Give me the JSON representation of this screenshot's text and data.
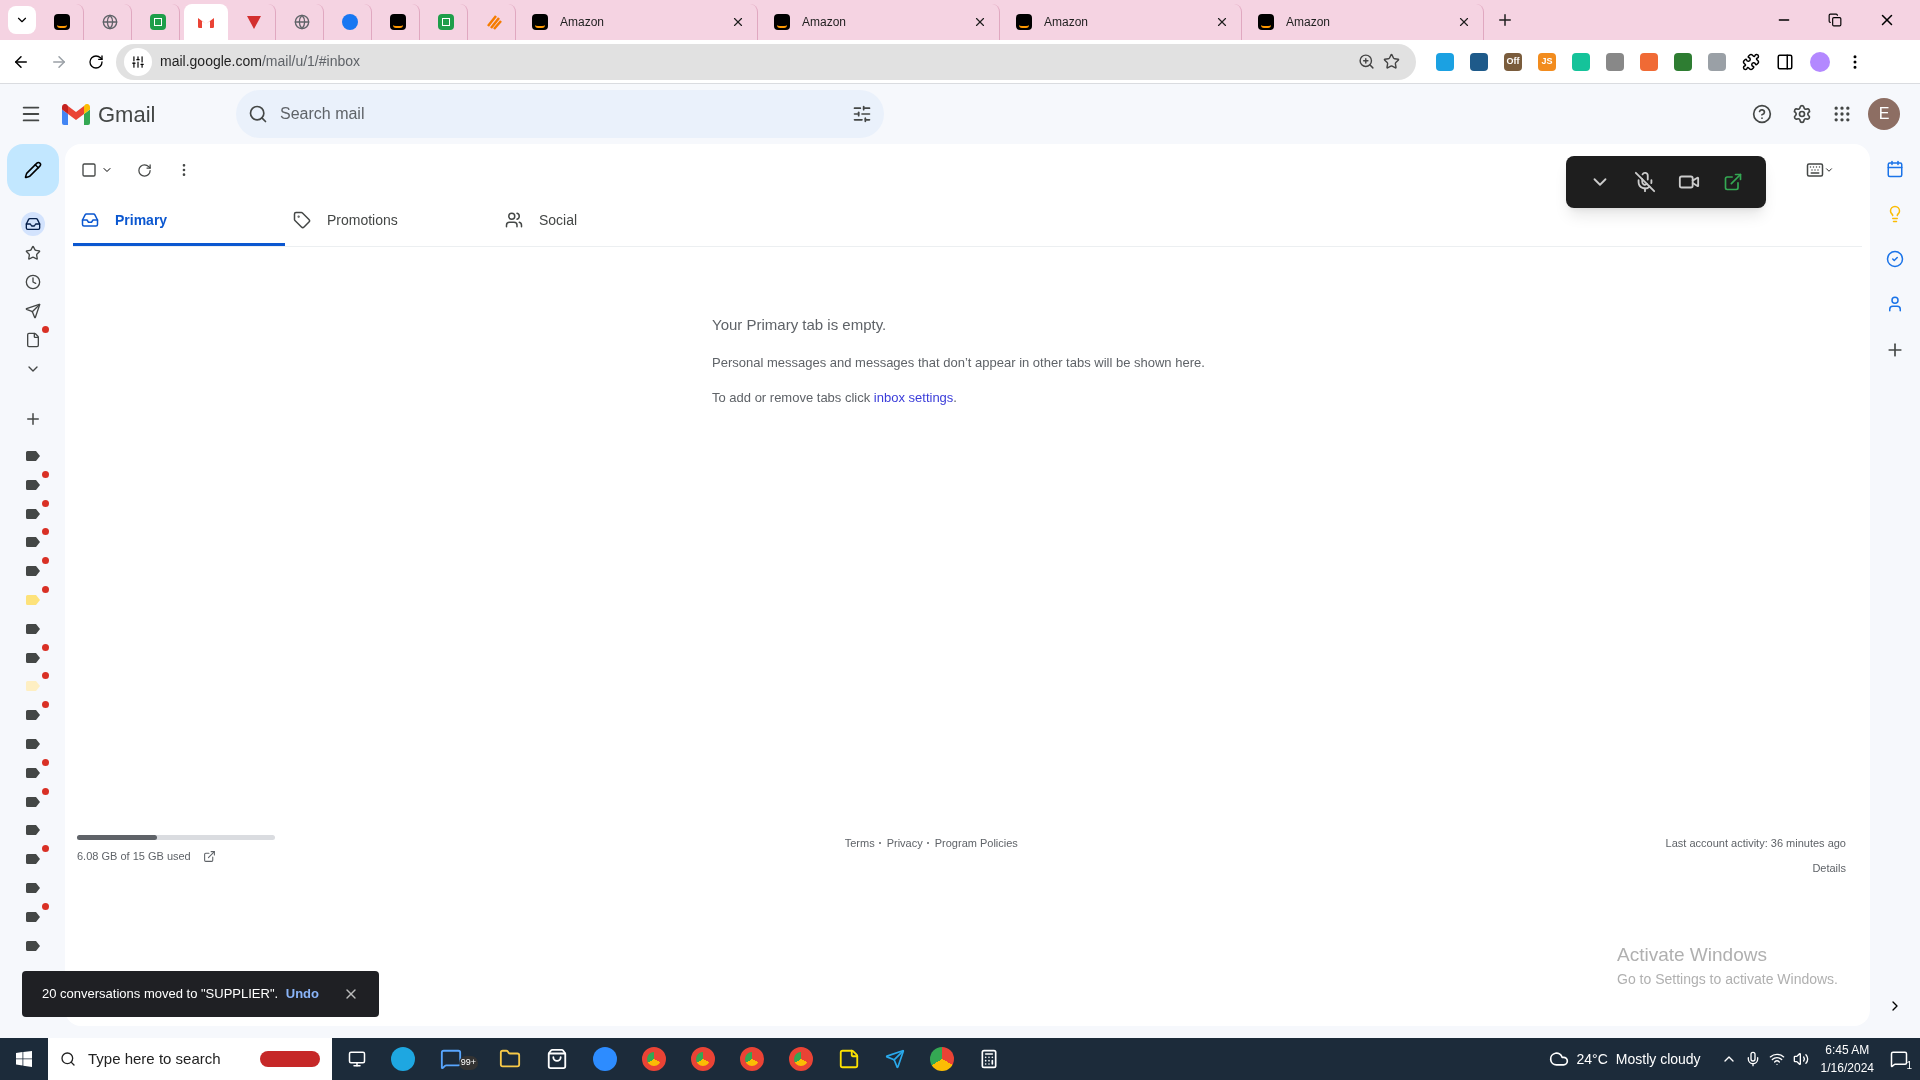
{
  "browser": {
    "tabs": [
      {
        "kind": "amazon",
        "selected": false
      },
      {
        "kind": "globe",
        "selected": false
      },
      {
        "kind": "sheets",
        "selected": false
      },
      {
        "kind": "gmail",
        "selected": true
      },
      {
        "kind": "shield",
        "selected": false
      },
      {
        "kind": "globe",
        "selected": false
      },
      {
        "kind": "facebook",
        "selected": false
      },
      {
        "kind": "amazon",
        "selected": false
      },
      {
        "kind": "sheets",
        "selected": false
      },
      {
        "kind": "stripes",
        "selected": false
      },
      {
        "kind": "amazon",
        "selected": false,
        "label": "Amazon"
      },
      {
        "kind": "amazon",
        "selected": false,
        "label": "Amazon"
      },
      {
        "kind": "amazon",
        "selected": false,
        "label": "Amazon"
      },
      {
        "kind": "amazon",
        "selected": false,
        "label": "Amazon"
      }
    ],
    "url_host": "mail.google.com",
    "url_path": "/mail/u/1/#inbox",
    "extensions": [
      {
        "color": "#1ba1e2"
      },
      {
        "color": "#1e5a8a"
      },
      {
        "color": "#7a5c3c",
        "label": "Off"
      },
      {
        "color": "#f28c1e",
        "label": "JS"
      },
      {
        "color": "#15c39a"
      },
      {
        "color": "#888888"
      },
      {
        "color": "#f06a35"
      },
      {
        "color": "#2e7d32"
      },
      {
        "color": "#9aa0a6"
      }
    ]
  },
  "gmail": {
    "logo_text": "Gmail",
    "search": {
      "placeholder": "Search mail"
    },
    "avatar": "E",
    "rail": [
      {
        "kind": "inbox",
        "selected": true,
        "dot": false
      },
      {
        "kind": "star",
        "selected": false,
        "dot": false
      },
      {
        "kind": "clock",
        "selected": false,
        "dot": false
      },
      {
        "kind": "send",
        "selected": false,
        "dot": false
      },
      {
        "kind": "draft",
        "selected": false,
        "dot": true
      },
      {
        "kind": "more",
        "selected": false,
        "dot": false
      }
    ],
    "labels": [
      {
        "color": "#444746",
        "dot": false
      },
      {
        "color": "#444746",
        "dot": true
      },
      {
        "color": "#444746",
        "dot": true
      },
      {
        "color": "#444746",
        "dot": true
      },
      {
        "color": "#444746",
        "dot": true
      },
      {
        "color": "#fde27a",
        "dot": true
      },
      {
        "color": "#444746",
        "dot": false
      },
      {
        "color": "#444746",
        "dot": true
      },
      {
        "color": "#feefc3",
        "dot": true
      },
      {
        "color": "#444746",
        "dot": true
      },
      {
        "color": "#444746",
        "dot": false
      },
      {
        "color": "#444746",
        "dot": true
      },
      {
        "color": "#444746",
        "dot": true
      },
      {
        "color": "#444746",
        "dot": false
      },
      {
        "color": "#444746",
        "dot": true
      },
      {
        "color": "#444746",
        "dot": false
      },
      {
        "color": "#444746",
        "dot": true
      },
      {
        "color": "#444746",
        "dot": false
      }
    ],
    "categories": [
      {
        "kind": "inbox",
        "label": "Primary",
        "selected": true
      },
      {
        "kind": "tag",
        "label": "Promotions",
        "selected": false
      },
      {
        "kind": "people",
        "label": "Social",
        "selected": false
      }
    ],
    "empty": {
      "title": "Your Primary tab is empty.",
      "body": "Personal messages and messages that don’t appear in other tabs will be shown here.",
      "hint": "To add or remove tabs click",
      "link": "inbox settings",
      "after_link": "."
    },
    "storage": {
      "level": 0.405,
      "text": "6.08 GB of 15 GB used"
    },
    "footer_links": [
      "Terms",
      "Privacy",
      "Program Policies"
    ],
    "activity": {
      "text": "Last account activity: 36 minutes ago",
      "details": "Details"
    },
    "toast": {
      "message": "20 conversations moved to \"SUPPLIER\".",
      "action": "Undo"
    }
  },
  "activation": {
    "title": "Activate Windows",
    "subtitle": "Go to Settings to activate Windows."
  },
  "taskbar": {
    "search_placeholder": "Type here to search",
    "mail_badge": "99+",
    "temperature": "24°C",
    "weather": "Mostly cloudy",
    "time": "6:45 AM",
    "date": "1/16/2024",
    "notifications": "1"
  }
}
